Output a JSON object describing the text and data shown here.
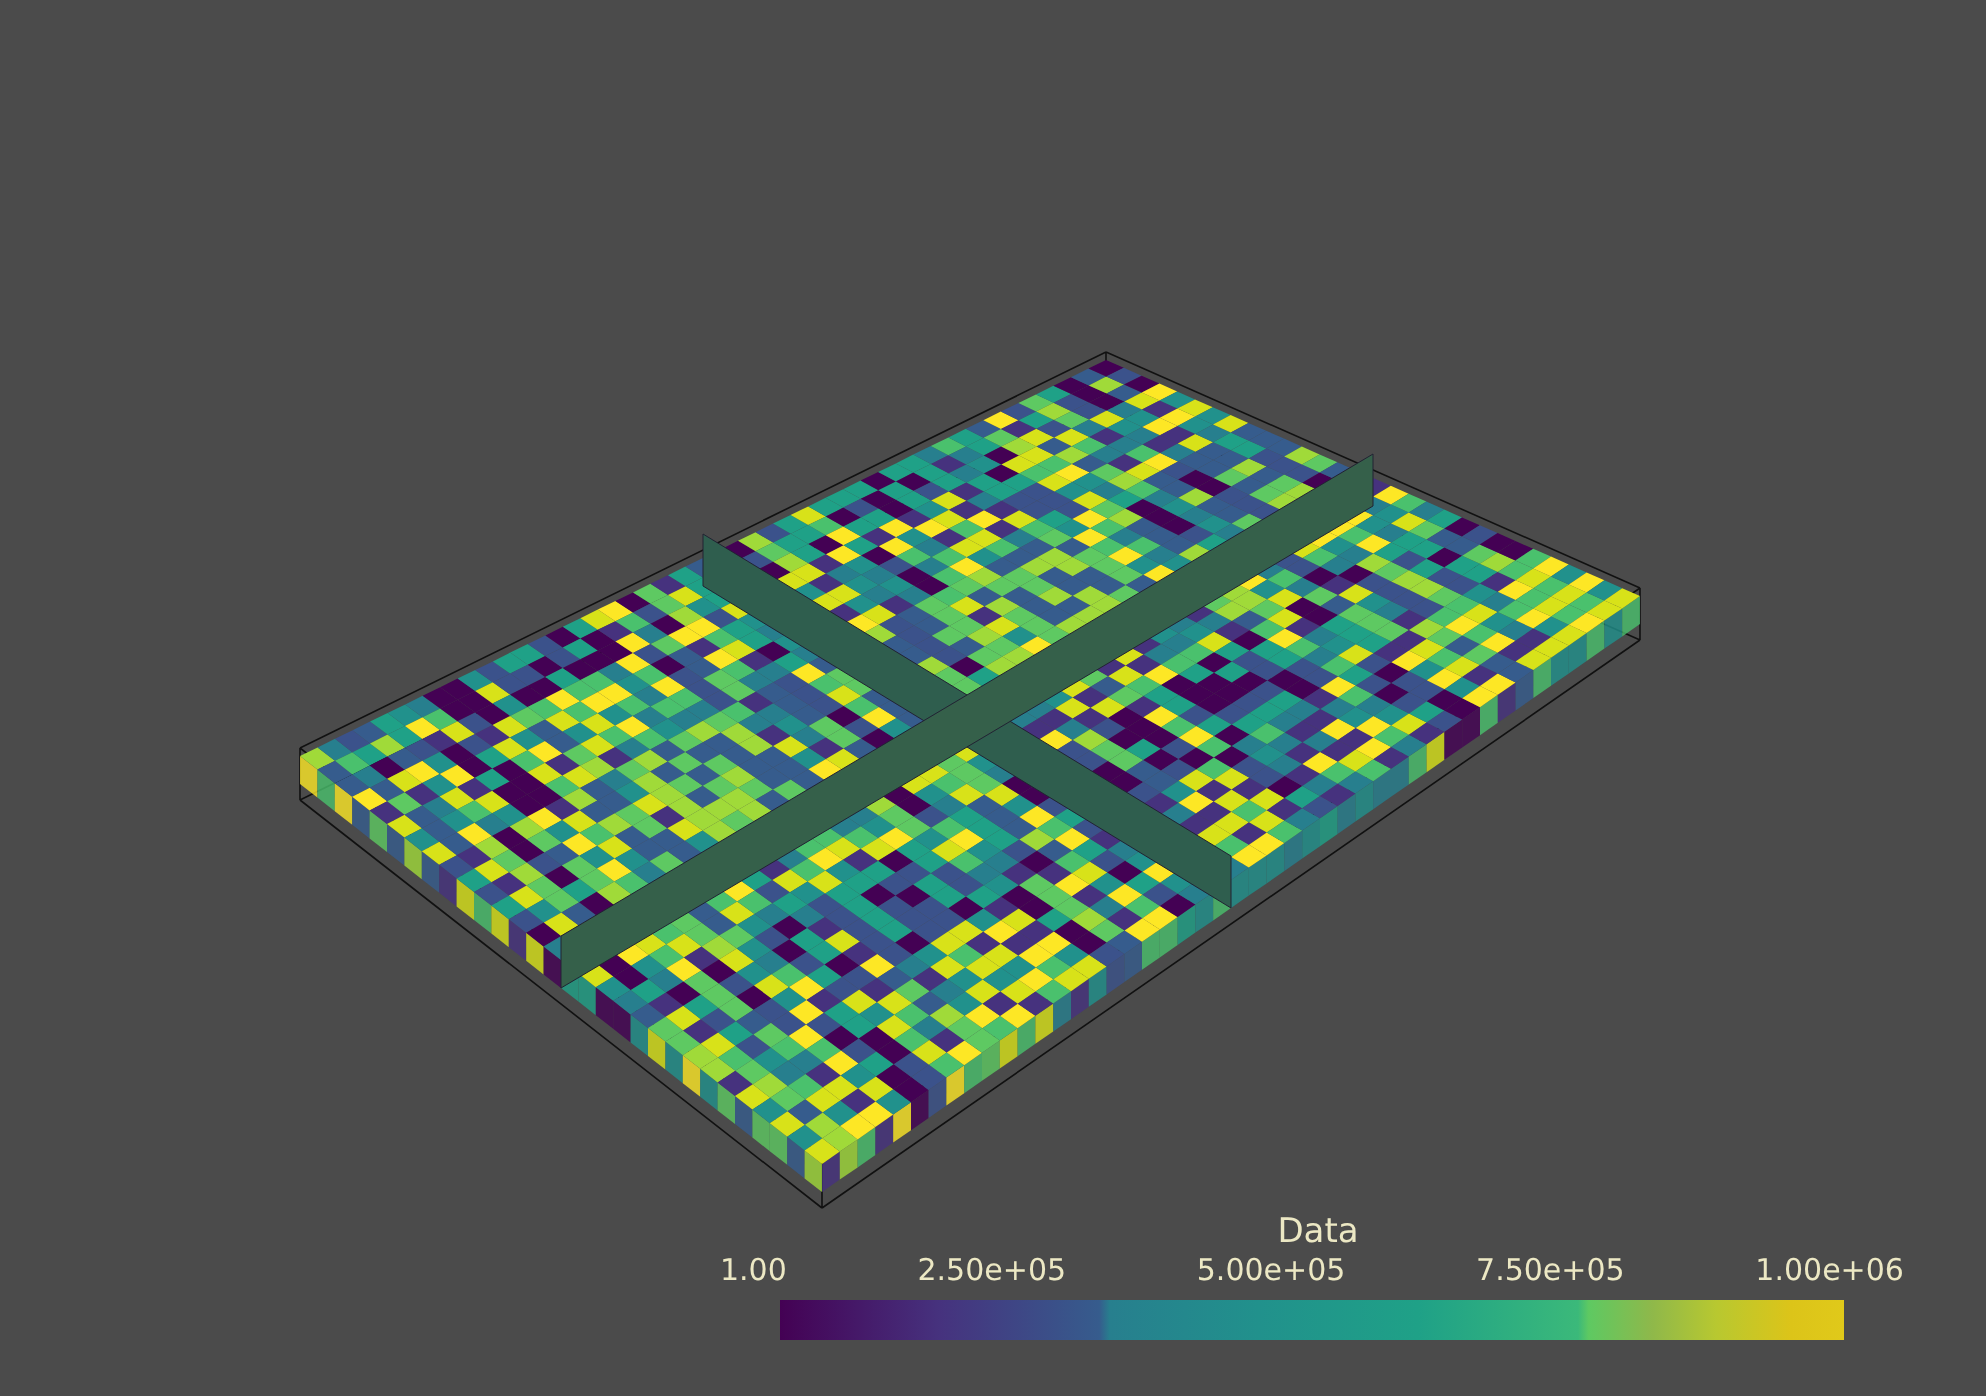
{
  "color_legend": {
    "title": "Data",
    "tick_labels": [
      "1.00",
      "2.50e+05",
      "5.00e+05",
      "7.50e+05",
      "1.00e+06"
    ]
  }
}
